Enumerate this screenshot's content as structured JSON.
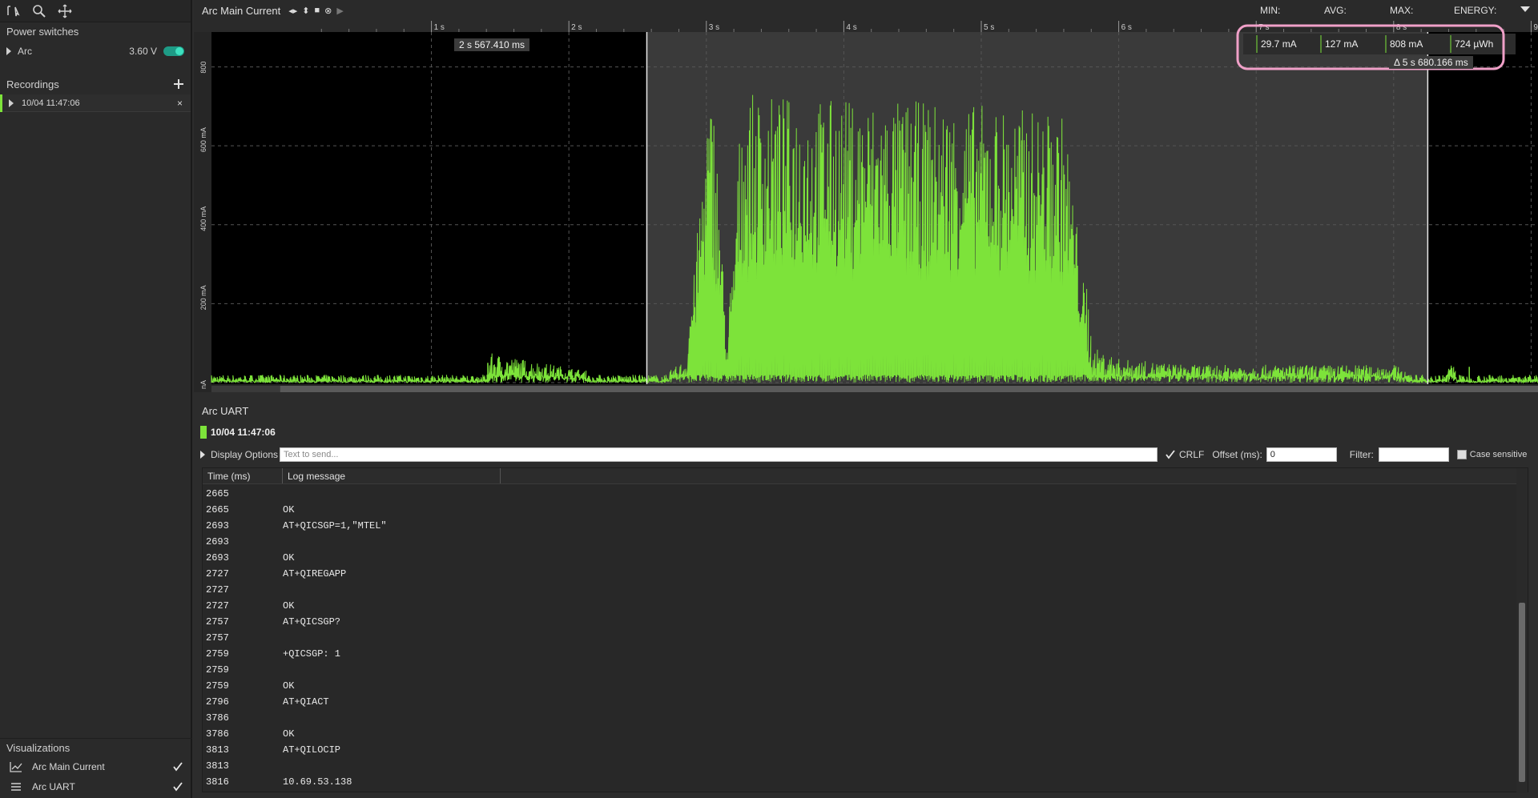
{
  "sidebar": {
    "power_switches_title": "Power switches",
    "device": {
      "name": "Arc",
      "voltage": "3.60 V"
    },
    "recordings_title": "Recordings",
    "recording": {
      "timestamp": "10/04 11:47:06"
    },
    "visualizations_title": "Visualizations",
    "visualizations": [
      {
        "label": "Arc Main Current",
        "checked": true
      },
      {
        "label": "Arc UART",
        "checked": true
      }
    ]
  },
  "plot": {
    "title": "Arc Main Current",
    "stat_labels": {
      "min": "MIN:",
      "avg": "AVG:",
      "max": "MAX:",
      "energy": "ENERGY:"
    },
    "stat_values": {
      "min": "29.7 mA",
      "avg": "127 mA",
      "max": "808 mA",
      "energy": "724 µWh"
    },
    "cursor_left_label": "2 s 567.410 ms",
    "cursor_delta_label": "Δ 5 s 680.166 ms",
    "trace_color": "#7de33a",
    "highlight_color": "#f0a0c8"
  },
  "chart_data": {
    "type": "line",
    "x_ticks": [
      "1 s",
      "2 s",
      "3 s",
      "4 s",
      "5 s",
      "6 s",
      "7 s",
      "8 s",
      "9 s"
    ],
    "y_ticks": [
      "nA",
      "200 mA",
      "400 mA",
      "600 mA",
      "800"
    ],
    "xlim": [
      0,
      9
    ],
    "ylim": [
      0,
      808
    ],
    "grid": true,
    "selection_start_s": 2.567,
    "selection_end_s": 8.248,
    "series": [
      {
        "x": [
          1.4,
          1.42,
          2.6,
          2.85,
          3.0,
          3.05,
          3.15,
          3.25,
          4.0,
          4.9,
          5.2,
          5.6,
          5.8,
          5.9,
          6.0,
          6.5,
          7.0,
          7.5,
          8.0,
          8.25,
          8.35,
          8.4,
          8.5
        ],
        "y": [
          0,
          50,
          0,
          40,
          700,
          720,
          60,
          730,
          720,
          710,
          700,
          680,
          60,
          50,
          40,
          30,
          30,
          30,
          30,
          0,
          0,
          40,
          0
        ]
      }
    ]
  },
  "uart": {
    "title": "Arc UART",
    "recording": "10/04 11:47:06",
    "display_options_label": "Display Options",
    "send_placeholder": "Text to send...",
    "crlf_label": "CRLF",
    "offset_label": "Offset (ms):",
    "offset_value": "0",
    "filter_label": "Filter:",
    "case_sensitive_label": "Case sensitive",
    "col_time": "Time (ms)",
    "col_msg": "Log message",
    "rows": [
      {
        "t": "2665",
        "m": ""
      },
      {
        "t": "2665",
        "m": "OK"
      },
      {
        "t": "2693",
        "m": "AT+QICSGP=1,\"MTEL\""
      },
      {
        "t": "2693",
        "m": ""
      },
      {
        "t": "2693",
        "m": "OK"
      },
      {
        "t": "2727",
        "m": "AT+QIREGAPP"
      },
      {
        "t": "2727",
        "m": ""
      },
      {
        "t": "2727",
        "m": "OK"
      },
      {
        "t": "2757",
        "m": "AT+QICSGP?"
      },
      {
        "t": "2757",
        "m": ""
      },
      {
        "t": "2759",
        "m": "+QICSGP: 1"
      },
      {
        "t": "2759",
        "m": ""
      },
      {
        "t": "2759",
        "m": "OK"
      },
      {
        "t": "2796",
        "m": "AT+QIACT"
      },
      {
        "t": "3786",
        "m": ""
      },
      {
        "t": "3786",
        "m": "OK"
      },
      {
        "t": "3813",
        "m": "AT+QILOCIP"
      },
      {
        "t": "3813",
        "m": ""
      },
      {
        "t": "3816",
        "m": "10.69.53.138"
      }
    ]
  }
}
